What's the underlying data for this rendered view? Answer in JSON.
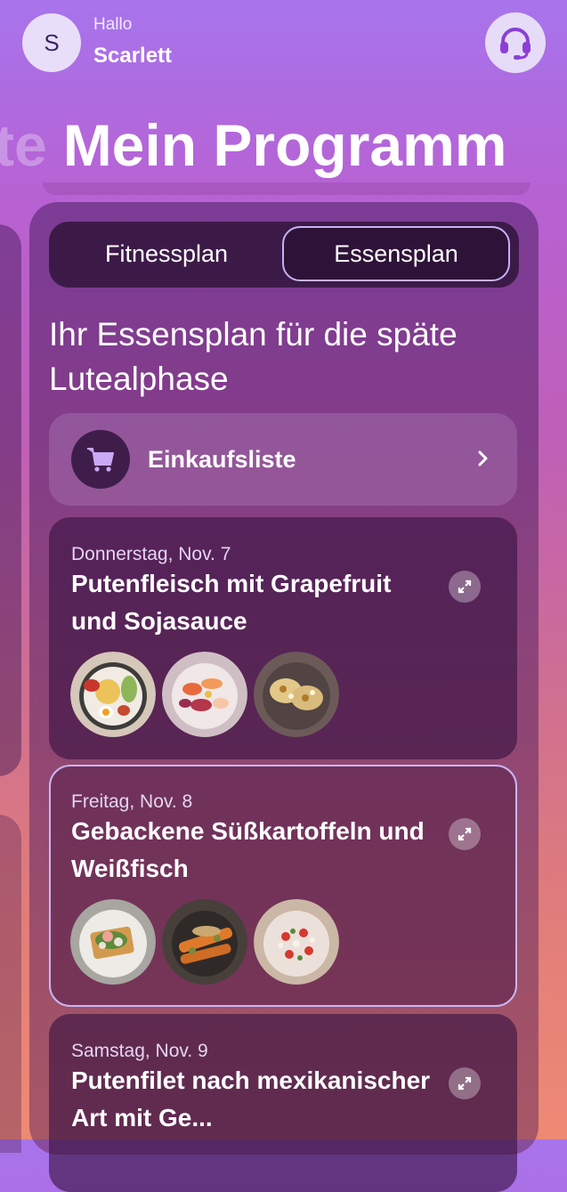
{
  "header": {
    "avatar_initial": "S",
    "greeting": "Hallo",
    "user_name": "Scarlett",
    "support_icon": "headset-icon"
  },
  "page": {
    "title_prev_fragment": "te",
    "title": "Mein Programm"
  },
  "tabs": [
    {
      "label": "Fitnessplan",
      "active": false
    },
    {
      "label": "Essensplan",
      "active": true
    }
  ],
  "plan": {
    "title": "Ihr Essensplan für die späte Lutealphase"
  },
  "shopping_list": {
    "label": "Einkaufsliste",
    "icon": "shopping-cart-icon"
  },
  "meals": [
    {
      "date": "Donnerstag, Nov. 7",
      "title": "Putenfleisch mit Grapefruit und Sojasauce",
      "selected": false
    },
    {
      "date": "Freitag, Nov. 8",
      "title": "Gebackene Süßkartoffeln und Weißfisch",
      "selected": true
    },
    {
      "date": "Samstag, Nov. 9",
      "title": "Putenfilet nach mexikanischer Art mit Ge...",
      "selected": false
    }
  ],
  "colors": {
    "accent_border": "#c8b6f4",
    "tab_bg": "#3c1a48",
    "background_top": "#a774ec",
    "background_bottom": "#ee8a74"
  }
}
